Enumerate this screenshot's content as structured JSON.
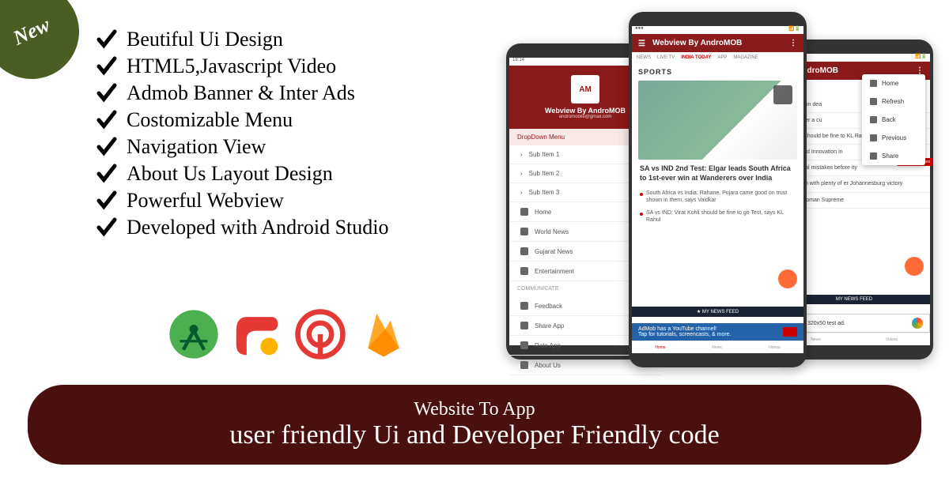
{
  "badge": "New",
  "features": [
    "Beutiful Ui Design",
    "HTML5,Javascript Video",
    "Admob Banner & Inter Ads",
    "Costomizable Menu",
    "Navigation View",
    "About Us Layout Design",
    "Powerful Webview",
    "Developed with Android Studio"
  ],
  "tech_icons": [
    "android-studio",
    "admob",
    "onesignal",
    "firebase"
  ],
  "banner": {
    "line1": "Website To App",
    "line2": "user friendly Ui and Developer Friendly code"
  },
  "phone1": {
    "status_time": "18:14",
    "logo": "AM",
    "drawer_title": "Webview By AndroMOB",
    "drawer_subtitle": "andromobile@gmail.com",
    "section": "DropDown Menu",
    "sub_items": [
      "Sub Item 1",
      "Sub Item 2",
      "Sub Item 3"
    ],
    "nav_items": [
      "Home",
      "World News",
      "Gujarat News",
      "Entertainment"
    ],
    "comm_label": "Communicate",
    "comm_items": [
      "Feedback",
      "Share App",
      "Rate App",
      "About Us"
    ]
  },
  "phone2": {
    "app_title": "Webview By AndroMOB",
    "tabs": [
      "NEWS",
      "LIVE TV",
      "INDIA TODAY",
      "APP",
      "MAGAZINE"
    ],
    "section": "SPORTS",
    "headline": "SA vs IND 2nd Test: Elgar leads South Africa to 1st-ever win at Wanderers over India",
    "bullets": [
      "South Africa vs India: Rahane, Pujara came good on trust shown in them, says Vaidkar",
      "SA vs IND: Virat Kohli should be fine to go Test, says KL Rahul"
    ],
    "feed": "★ MY NEWS FEED",
    "ad_line1": "AdMob has a YouTube channel!",
    "ad_line2": "Tap for tutorials, screencasts, & more.",
    "nav": [
      "Home",
      "News",
      "Videos"
    ]
  },
  "phone3": {
    "app_title": "By AndroMOB",
    "menu": [
      "Home",
      "Refresh",
      "Back",
      "Previous",
      "Share"
    ],
    "red_tag": "Pause Headlines",
    "snippets": [
      "ha repe on dea",
      "owed f ver a cu",
      "at Kohli should be fine to KL Rahul",
      "llence and Innovation in",
      "e financial mistakes before ity",
      "ape Town with plenty of er Johannesburg victory",
      "its first woman Supreme"
    ],
    "feed": "MY NEWS FEED",
    "ad": "This is a 320x50 test ad.",
    "nav": [
      "News",
      "Videos"
    ]
  }
}
